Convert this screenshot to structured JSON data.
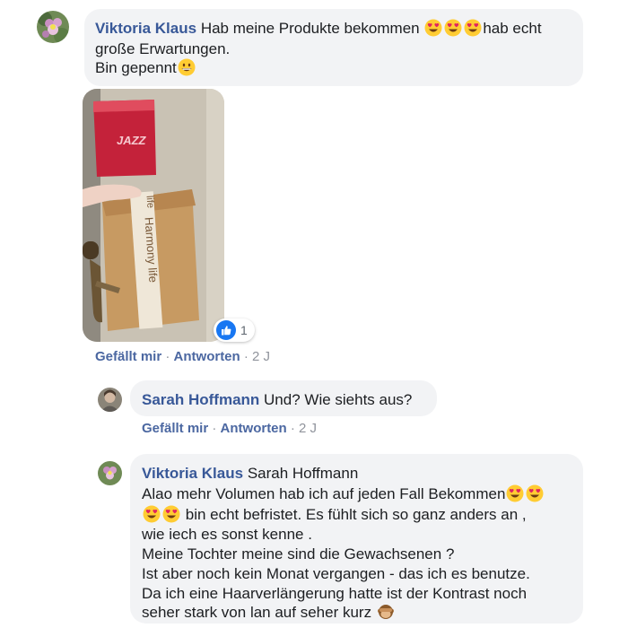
{
  "comments": [
    {
      "author": "Viktoria Klaus",
      "lines": [
        "Hab meine Produkte bekommen",
        "hab echt",
        "große Erwartungen.",
        "Bin gepennt"
      ],
      "reaction_count": "1",
      "actions": {
        "like": "Gefällt mir",
        "reply": "Antworten",
        "time": "2 J"
      }
    },
    {
      "author": "Sarah Hoffmann",
      "text": "Und? Wie siehts aus?",
      "actions": {
        "like": "Gefällt mir",
        "reply": "Antworten",
        "time": "2 J"
      }
    },
    {
      "author": "Viktoria Klaus",
      "mention": "Sarah Hoffmann",
      "lines": [
        "Alao mehr Volumen hab ich auf jeden Fall Bekommen",
        "bin echt befristet. Es fühlt sich so ganz anders an ,",
        "wie iech es sonst kenne .",
        "Meine Tochter meine sind die Gewachsenen ?",
        "Ist aber noch kein Monat vergangen - das ich es benutze.",
        "Da ich eine Haarverlängerung hatte ist der Kontrast noch",
        "seher stark von lan auf seher kurz"
      ]
    }
  ],
  "photo": {
    "bag_text": "JAZZ",
    "box_text": "Harmony life",
    "box_text_top": "life"
  },
  "icons": {
    "reaction": "thumbs-up-icon",
    "heart_eyes": "heart-eyes-emoji",
    "grin": "grinning-emoji",
    "monkey": "see-no-evil-monkey-emoji"
  },
  "colors": {
    "name": "#385898",
    "bubble": "#f2f3f5",
    "meta": "#90949c",
    "like_blue": "#1877f2"
  }
}
